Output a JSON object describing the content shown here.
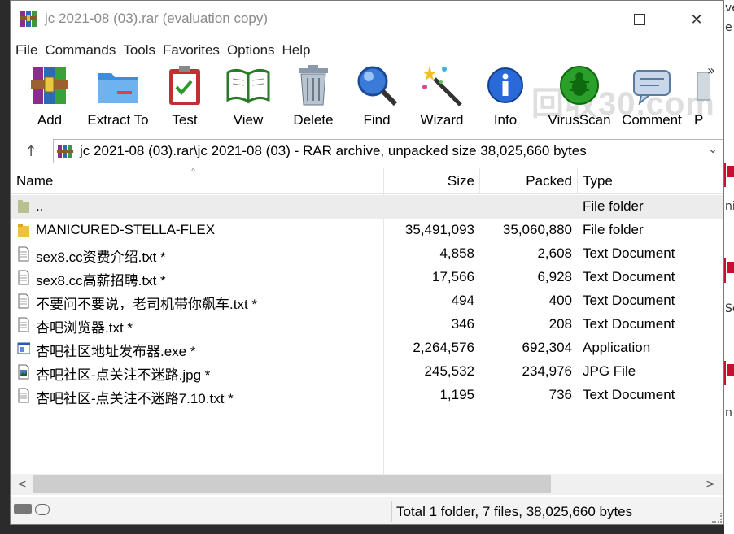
{
  "window": {
    "title": "jc 2021-08 (03).rar (evaluation copy)",
    "minimize": "—",
    "maximize": "☐",
    "close": "✕"
  },
  "menu": [
    "File",
    "Commands",
    "Tools",
    "Favorites",
    "Options",
    "Help"
  ],
  "toolbar": {
    "buttons": [
      {
        "label": "Add",
        "icon": "winrar-add-icon"
      },
      {
        "label": "Extract To",
        "icon": "folder-extract-icon"
      },
      {
        "label": "Test",
        "icon": "clipboard-check-icon"
      },
      {
        "label": "View",
        "icon": "book-view-icon"
      },
      {
        "label": "Delete",
        "icon": "trash-icon"
      },
      {
        "label": "Find",
        "icon": "magnifier-icon"
      },
      {
        "label": "Wizard",
        "icon": "magic-wand-icon"
      },
      {
        "label": "Info",
        "icon": "info-icon"
      },
      {
        "label": "VirusScan",
        "icon": "virus-scan-icon"
      },
      {
        "label": "Comment",
        "icon": "comment-icon"
      },
      {
        "label": "P",
        "icon": "protect-icon"
      }
    ],
    "more": "»",
    "watermark": "回收30.com"
  },
  "address": {
    "up": "↑",
    "path": "jc 2021-08 (03).rar\\jc 2021-08 (03) - RAR archive, unpacked size 38,025,660 bytes",
    "dropdown": "⌄"
  },
  "columns": {
    "name": "Name",
    "size": "Size",
    "packed": "Packed",
    "type": "Type",
    "sort_arrow": "^"
  },
  "files": [
    {
      "name": "..",
      "size": "",
      "packed": "",
      "type": "File folder",
      "icon": "folder-up-icon"
    },
    {
      "name": "MANICURED-STELLA-FLEX",
      "size": "35,491,093",
      "packed": "35,060,880",
      "type": "File folder",
      "icon": "folder-icon"
    },
    {
      "name": "sex8.cc资费介绍.txt *",
      "size": "4,858",
      "packed": "2,608",
      "type": "Text Document",
      "icon": "text-file-icon"
    },
    {
      "name": "sex8.cc高薪招聘.txt *",
      "size": "17,566",
      "packed": "6,928",
      "type": "Text Document",
      "icon": "text-file-icon"
    },
    {
      "name": "不要问不要说，老司机带你飙车.txt *",
      "size": "494",
      "packed": "400",
      "type": "Text Document",
      "icon": "text-file-icon"
    },
    {
      "name": "杏吧浏览器.txt *",
      "size": "346",
      "packed": "208",
      "type": "Text Document",
      "icon": "text-file-icon"
    },
    {
      "name": "杏吧社区地址发布器.exe *",
      "size": "2,264,576",
      "packed": "692,304",
      "type": "Application",
      "icon": "exe-file-icon"
    },
    {
      "name": "杏吧社区-点关注不迷路.jpg *",
      "size": "245,532",
      "packed": "234,976",
      "type": "JPG File",
      "icon": "image-file-icon"
    },
    {
      "name": "杏吧社区-点关注不迷路7.10.txt *",
      "size": "1,195",
      "packed": "736",
      "type": "Text Document",
      "icon": "text-file-icon"
    }
  ],
  "scrollbar": {
    "left": "<",
    "right": ">"
  },
  "status": {
    "text": "Total 1 folder, 7 files, 38,025,660 bytes"
  },
  "background_peek": [
    "ve",
    "e",
    "nic",
    "Se",
    "n"
  ]
}
